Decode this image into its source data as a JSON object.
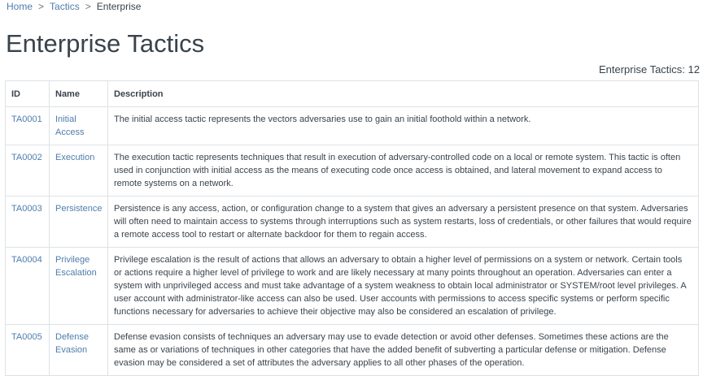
{
  "breadcrumb": {
    "home": "Home",
    "sep1": ">",
    "tactics": "Tactics",
    "sep2": ">",
    "current": "Enterprise"
  },
  "page_title": "Enterprise Tactics",
  "tactic_count": "Enterprise Tactics: 12",
  "table": {
    "headers": {
      "id": "ID",
      "name": "Name",
      "description": "Description"
    },
    "rows": [
      {
        "id": "TA0001",
        "name": "Initial Access",
        "description": "The initial access tactic represents the vectors adversaries use to gain an initial foothold within a network."
      },
      {
        "id": "TA0002",
        "name": "Execution",
        "description": "The execution tactic represents techniques that result in execution of adversary-controlled code on a local or remote system. This tactic is often used in conjunction with initial access as the means of executing code once access is obtained, and lateral movement to expand access to remote systems on a network."
      },
      {
        "id": "TA0003",
        "name": "Persistence",
        "description": "Persistence is any access, action, or configuration change to a system that gives an adversary a persistent presence on that system. Adversaries will often need to maintain access to systems through interruptions such as system restarts, loss of credentials, or other failures that would require a remote access tool to restart or alternate backdoor for them to regain access."
      },
      {
        "id": "TA0004",
        "name": "Privilege Escalation",
        "description": "Privilege escalation is the result of actions that allows an adversary to obtain a higher level of permissions on a system or network. Certain tools or actions require a higher level of privilege to work and are likely necessary at many points throughout an operation. Adversaries can enter a system with unprivileged access and must take advantage of a system weakness to obtain local administrator or SYSTEM/root level privileges. A user account with administrator-like access can also be used. User accounts with permissions to access specific systems or perform specific functions necessary for adversaries to achieve their objective may also be considered an escalation of privilege."
      },
      {
        "id": "TA0005",
        "name": "Defense Evasion",
        "description": "Defense evasion consists of techniques an adversary may use to evade detection or avoid other defenses. Sometimes these actions are the same as or variations of techniques in other categories that have the added benefit of subverting a particular defense or mitigation. Defense evasion may be considered a set of attributes the adversary applies to all other phases of the operation."
      }
    ]
  }
}
